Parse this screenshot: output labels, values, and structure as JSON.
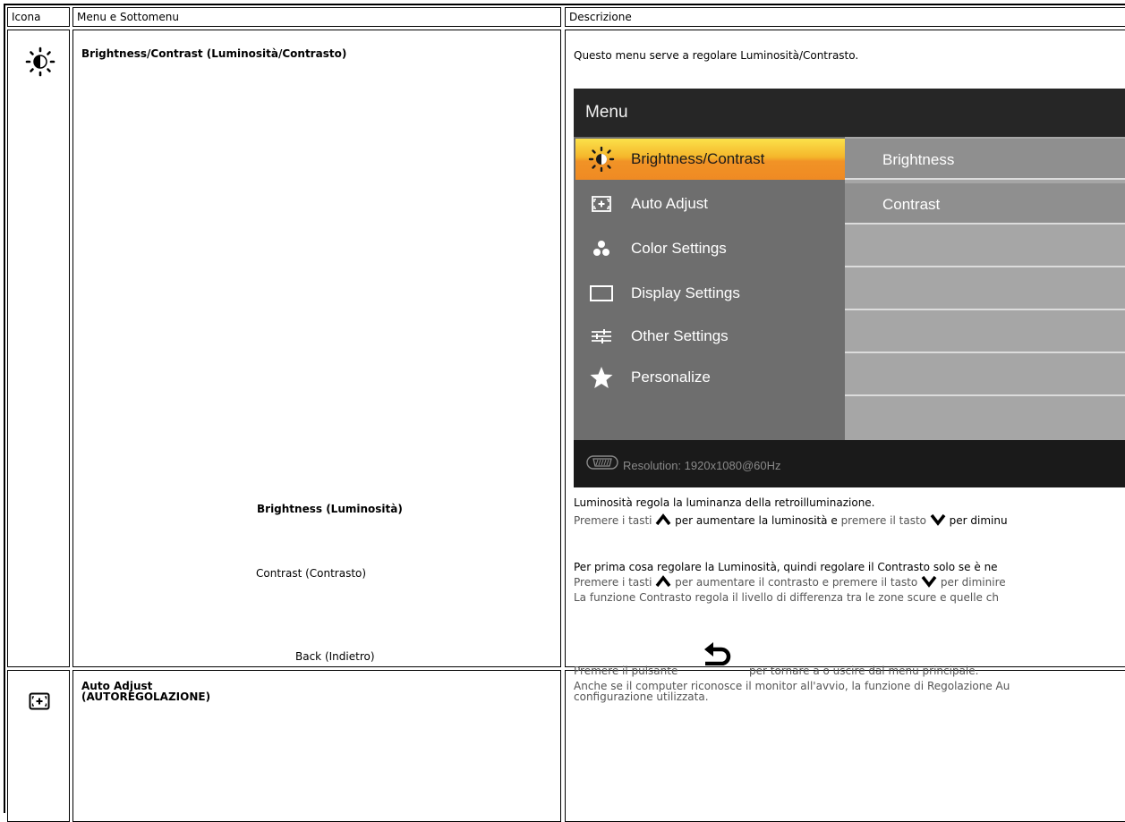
{
  "header": {
    "col_icon": "Icona",
    "col_menu": "Menu e Sottomenu",
    "col_desc": "Descrizione"
  },
  "brightness_contrast": {
    "icon": "sun-half-icon",
    "title": "Brightness/Contrast (Luminosità/Contrasto)",
    "intro": "Questo menu serve a regolare Luminosità/Contrasto."
  },
  "osd": {
    "title": "Menu",
    "menu_items": [
      {
        "label": "Brightness/Contrast",
        "icon": "sun-half-icon"
      },
      {
        "label": "Auto Adjust",
        "icon": "auto-adjust-icon"
      },
      {
        "label": "Color Settings",
        "icon": "color-dots-icon"
      },
      {
        "label": "Display Settings",
        "icon": "display-rectangle-icon"
      },
      {
        "label": "Other Settings",
        "icon": "sliders-icon"
      },
      {
        "label": "Personalize",
        "icon": "star-icon"
      }
    ],
    "submenu_items": [
      "Brightness",
      "Contrast"
    ],
    "footer": "Resolution:  1920x1080@60Hz",
    "footer_icon": "vga-connector-icon"
  },
  "brightness": {
    "label": "Brightness (Luminosità)",
    "line1": "Luminosità regola la luminanza della retroilluminazione.",
    "line2_a": "Premere i tasti ",
    "line2_b": "per aumentare la luminosità e ",
    "line2_c": "premere il tasto ",
    "line2_d": "per diminu"
  },
  "contrast": {
    "label": "Contrast (Contrasto)",
    "line1": "Per prima cosa regolare la Luminosità, quindi regolare il Contrasto solo se è ne",
    "line2_a": "Premere i tasti ",
    "line2_b": "per aumentare il contrasto e premere il tasto ",
    "line2_c": "per diminire",
    "line3": "La funzione Contrasto regola il livello di differenza tra le zone scure e quelle ch"
  },
  "back": {
    "label": "Back (Indietro)",
    "text_a": "Premere il pulsante",
    "text_b": "per tornare a o uscire dal menu principale."
  },
  "auto_adjust": {
    "icon": "auto-adjust-icon",
    "title_line1": "Auto Adjust",
    "title_line2": "(AUTOREGOLAZIONE)",
    "desc_line1": "Anche se il computer riconosce il monitor all'avvio, la funzione di Regolazione Au",
    "desc_line2": "configurazione utilizzata."
  }
}
